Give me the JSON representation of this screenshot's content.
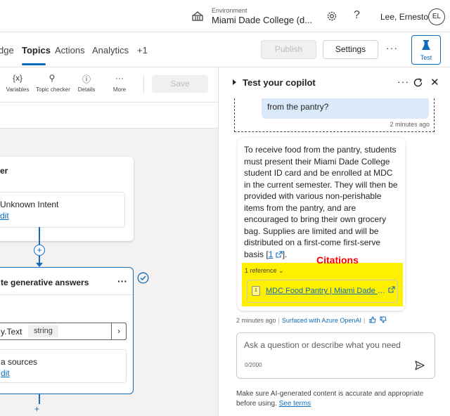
{
  "header": {
    "environment_label": "Environment",
    "environment_name": "Miami Dade College (d...",
    "help_glyph": "?",
    "user_name": "Lee, Ernesto",
    "avatar_initials": "EL"
  },
  "nav": {
    "tabs": [
      {
        "label": "dge"
      },
      {
        "label": "Topics",
        "active": true
      },
      {
        "label": "Actions"
      },
      {
        "label": "Analytics"
      },
      {
        "label": "+1"
      }
    ],
    "publish_label": "Publish",
    "settings_label": "Settings",
    "more_glyph": "···",
    "test_label": "Test"
  },
  "toolbar": {
    "items": [
      {
        "glyph": "{x}",
        "label": "Variables",
        "icon": "variables-icon"
      },
      {
        "glyph": "⚲",
        "label": "Topic checker",
        "icon": "stethoscope-icon"
      },
      {
        "glyph": "ⓘ",
        "label": "Details",
        "icon": "info-icon"
      },
      {
        "glyph": "···",
        "label": "More",
        "icon": "more-icon"
      }
    ],
    "save_label": "Save"
  },
  "canvas": {
    "trigger_title": "er",
    "intent_title": "Unknown Intent",
    "intent_edit": "dit",
    "plus_glyph": "+",
    "gen_title": "te generative answers",
    "gen_more": "···",
    "variable_text": "y.Text",
    "variable_type": "string",
    "chevron": "›",
    "sources_title": "a sources",
    "sources_edit": "dit",
    "bottom_plus": "+"
  },
  "test_panel": {
    "title": "Test your copilot",
    "more_glyph": "···",
    "close_glyph": "✕",
    "user_message": "from the pantry?",
    "user_time": "2 minutes ago",
    "bot_message": "To receive food from the pantry, students must present their Miami Dade College student ID card and be enrolled at MDC in the current semester. They will then be provided with various non-perishable items from the pantry, and are encouraged to bring their own grocery bag. Supplies are limited and will be distributed on a first-come first-serve basis",
    "inline_citation": "1",
    "message_end": "].",
    "reference_count": "1 reference",
    "reference_number": "1",
    "reference_title": "MDC Food Pantry | Miami Dade C...",
    "annotation": "Citations",
    "bot_time": "2 minutes ago",
    "surfaced_label": "Surfaced with Azure OpenAI",
    "input_placeholder": "Ask a question or describe what you need",
    "char_counter": "0/2000",
    "disclaimer": "Make sure AI-generated content is accurate and appropriate before using.",
    "see_terms": "See terms"
  },
  "colors": {
    "accent": "#0f6cbd",
    "highlight": "#fff000",
    "annotation": "#ff0000"
  }
}
